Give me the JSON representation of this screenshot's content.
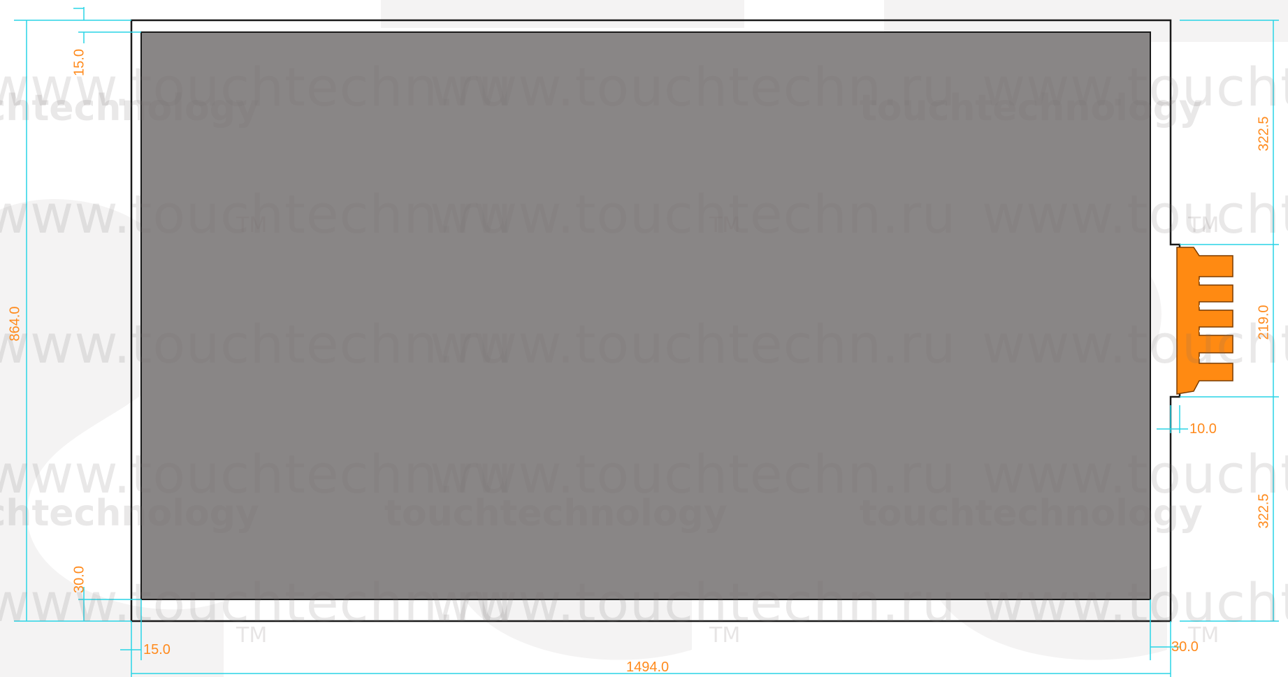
{
  "watermark": {
    "url_text": "www.touchtechn.ru",
    "brand_text": "touchtechnology",
    "tm_text": "TM"
  },
  "dimensions": {
    "total_width": "1494.0",
    "total_height": "864.0",
    "top_border": "15.0",
    "bottom_border": "30.0",
    "left_border": "15.0",
    "right_border": "30.0",
    "top_to_tail": "322.5",
    "tail_width": "219.0",
    "bottom_to_tail": "322.5",
    "tail_offset": "10.0"
  },
  "colors": {
    "active_area": "#898686",
    "outline": "#1a1a1a",
    "dimension_line": "#28d4e6",
    "dimension_text": "#ff8a1c",
    "fpc_tail": "#ff8a12"
  }
}
